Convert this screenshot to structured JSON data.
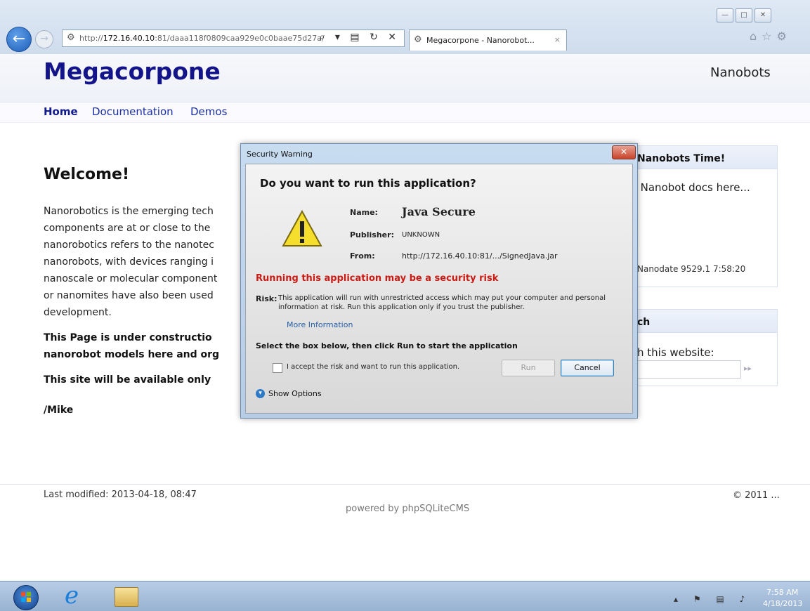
{
  "browser": {
    "url_prefix": "http://",
    "url_host": "172.16.40.10",
    "url_rest": ":81/daaa118f0809caa929e0c0baae75d27a/",
    "address_tools": "⌕ ▾ ▤ ↻ ✕",
    "tab_title": "Megacorpone - Nanorobot...",
    "tab_close": "×",
    "right_icons": "⌂☆⚙",
    "window_buttons": [
      "—",
      "□",
      "✕"
    ]
  },
  "site": {
    "name": "Megacorpone",
    "tagline": "Nanobots"
  },
  "nav": {
    "home": "Home",
    "documentation": "Documentation",
    "demos": "Demos"
  },
  "main": {
    "heading": "Welcome!",
    "paragraph_lines": [
      "Nanorobotics is the emerging tech",
      "components are at or close to the",
      "nanorobotics refers to the nanotec",
      "nanorobots, with devices ranging i",
      "nanoscale or molecular component",
      "or nanomites have also been used",
      "development."
    ],
    "construction_lines": [
      "This Page is under constructio",
      "nanorobot models here and org"
    ],
    "availability": "This site will be available only",
    "signature": "/Mike"
  },
  "sidebar": {
    "box1_title": "Nanobots Time!",
    "box1_text": "t Nanobot docs here...",
    "box1_nanodate": "Nanodate 9529.1 7:58:20",
    "box2_title": "ch",
    "box2_text": "h this website:",
    "box2_go": "▸▸"
  },
  "footer": {
    "last_modified": "Last modified: 2013-04-18, 08:47",
    "copyright": "© 2011 ...",
    "powered": "powered by phpSQLiteCMS"
  },
  "dialog": {
    "title": "Security Warning",
    "close": "✕",
    "question": "Do you want to run this application?",
    "name_label": "Name:",
    "name_value": "Java Secure",
    "publisher_label": "Publisher:",
    "publisher_value": "UNKNOWN",
    "from_label": "From:",
    "from_value": "http://172.16.40.10:81/.../SignedJava.jar",
    "risk_heading": "Running this application may be a security risk",
    "risk_label": "Risk:",
    "risk_text": "This application will run with unrestricted access which may put your computer and personal information at risk. Run this application only if you trust the publisher.",
    "more_info": "More Information",
    "select_text": "Select the box below, then click Run to start the application",
    "checkbox_label": "I accept the risk and want to run this application.",
    "run_label": "Run",
    "cancel_label": "Cancel",
    "show_options": "Show Options"
  },
  "taskbar": {
    "tray_icons": "▴ ⚑ ▤ ♪",
    "time": "7:58 AM",
    "date": "4/18/2013"
  }
}
